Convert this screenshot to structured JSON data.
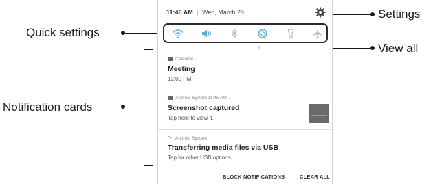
{
  "status_bar": {
    "time": "11:46 AM",
    "separator": "|",
    "date": "Wed, March 29"
  },
  "quick_settings": {
    "icons": [
      "wifi-icon",
      "sound-icon",
      "bluetooth-icon",
      "auto-rotate-icon",
      "flashlight-icon",
      "airplane-mode-icon"
    ],
    "active_color": "#5aa8e8",
    "inactive_color": "#b5b5b5"
  },
  "notifications": [
    {
      "app": "Calendar ⌄",
      "title": "Meeting",
      "body": "12:00 PM"
    },
    {
      "app": "Android System  11:45 AM ⌄",
      "title": "Screenshot captured",
      "body": "Tap here to view it."
    },
    {
      "app": "Android System",
      "title": "Transferring media files via USB",
      "body": "Tap for other USB options."
    }
  ],
  "footer": {
    "block_label": "BLOCK NOTIFICATIONS",
    "clear_label": "CLEAR ALL"
  },
  "callouts": {
    "settings": "Settings",
    "quick_settings": "Quick settings",
    "view_all": "View all",
    "notification_cards": "Notification cards"
  }
}
